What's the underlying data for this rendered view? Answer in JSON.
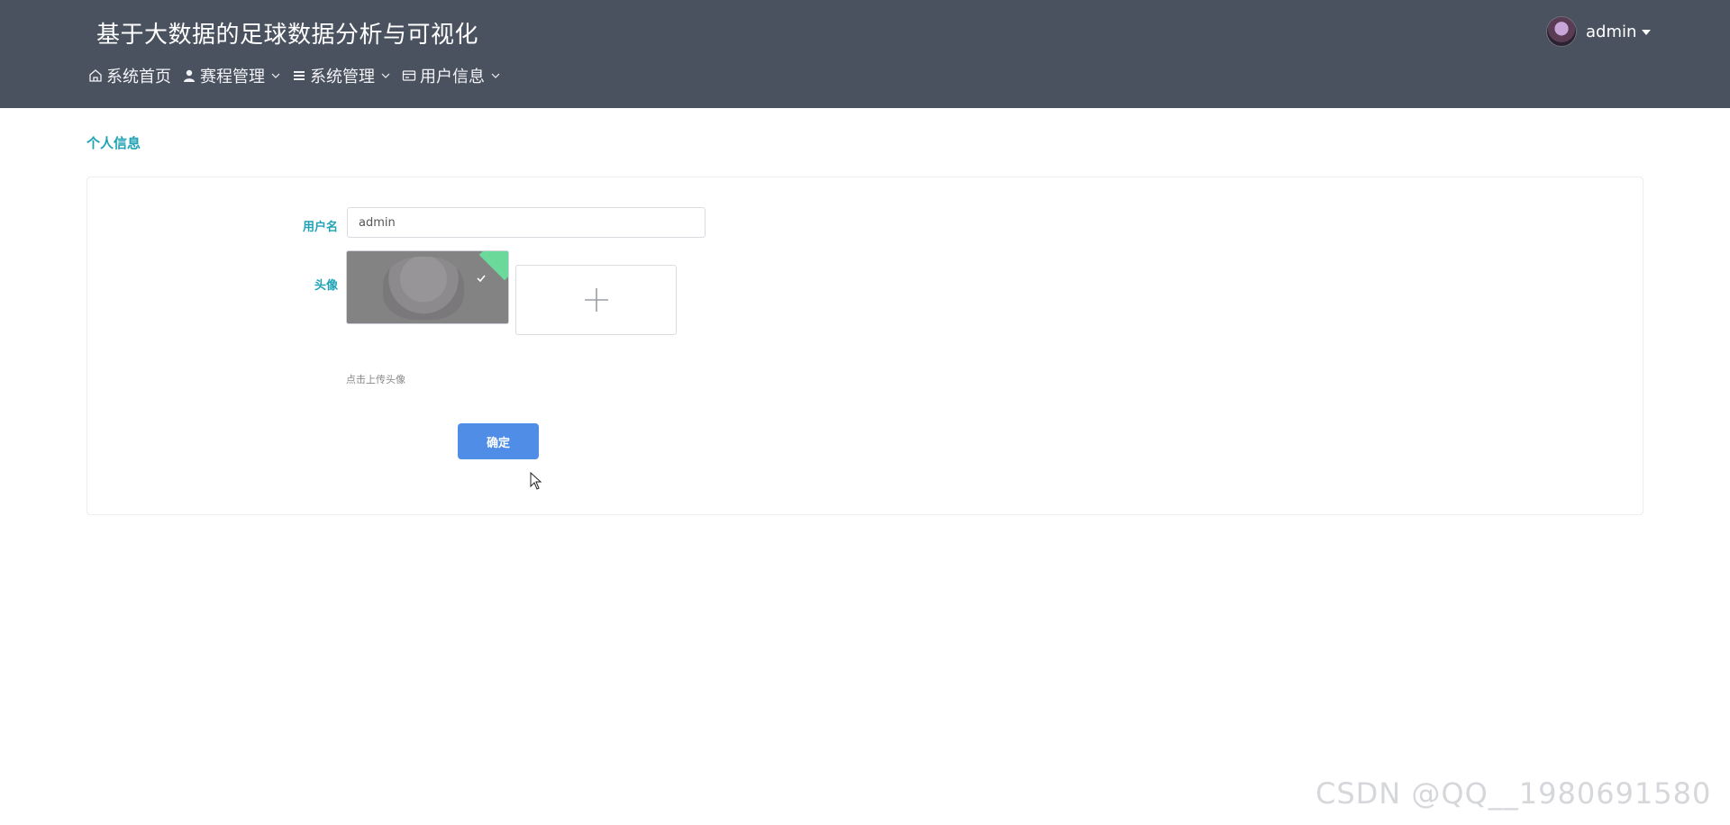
{
  "app": {
    "title": "基于大数据的足球数据分析与可视化"
  },
  "nav": {
    "items": [
      {
        "label": "系统首页",
        "icon": "home-icon",
        "has_dropdown": false
      },
      {
        "label": "赛程管理",
        "icon": "user-icon",
        "has_dropdown": true
      },
      {
        "label": "系统管理",
        "icon": "list-icon",
        "has_dropdown": true
      },
      {
        "label": "用户信息",
        "icon": "card-icon",
        "has_dropdown": true
      }
    ]
  },
  "user": {
    "name": "admin"
  },
  "page": {
    "section_title": "个人信息"
  },
  "form": {
    "username_label": "用户名",
    "username_value": "admin",
    "avatar_label": "头像",
    "upload_hint": "点击上传头像",
    "confirm_label": "确定"
  },
  "watermark": {
    "text": "CSDN @QQ__1980691580"
  },
  "colors": {
    "header_bg": "#4a515f",
    "accent": "#1fa3b5",
    "primary_button": "#4f8de6",
    "success_corner": "#6ad99a"
  }
}
